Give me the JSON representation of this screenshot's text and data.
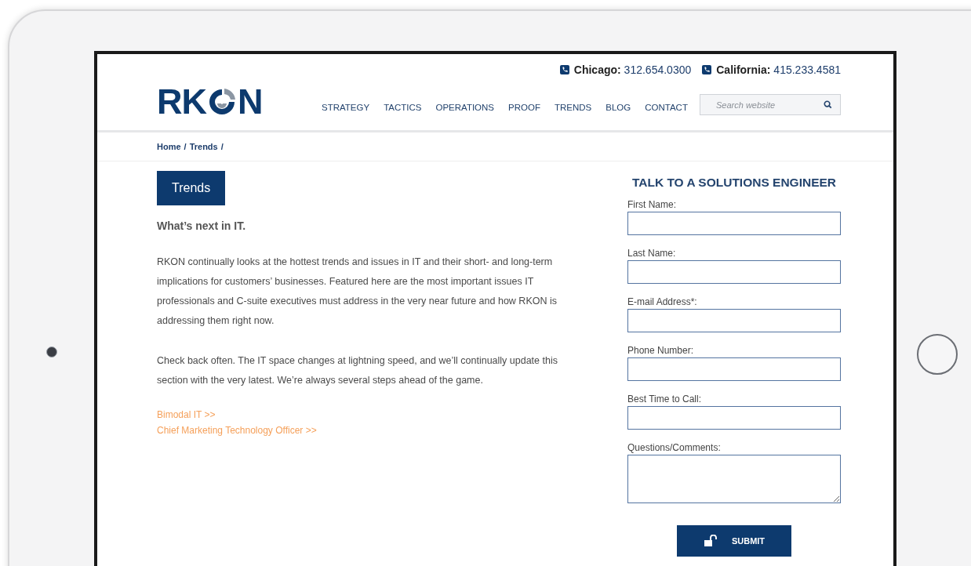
{
  "contacts": [
    {
      "label": "Chicago:",
      "number": "312.654.0300"
    },
    {
      "label": "California:",
      "number": "415.233.4581"
    }
  ],
  "logo": {
    "before": "RK",
    "after": "N"
  },
  "nav": [
    "STRATEGY",
    "TACTICS",
    "OPERATIONS",
    "PROOF",
    "TRENDS",
    "BLOG",
    "CONTACT"
  ],
  "search": {
    "placeholder": "Search website"
  },
  "breadcrumb": [
    {
      "label": "Home",
      "separator": "/"
    },
    {
      "label": "Trends",
      "separator": "/"
    }
  ],
  "page_title": "Trends",
  "subtitle": "What’s next in IT.",
  "paragraphs": [
    "RKON continually looks at the hottest trends and issues in IT and their short- and long-term implications for customers’ businesses. Featured here are the most important issues IT professionals and C-suite executives must address in the very near future and how RKON is addressing them right now.",
    "Check back often. The IT space changes at lightning speed, and we’ll continually update this section with the very latest. We’re always several steps ahead of the game."
  ],
  "links": [
    "Bimodal IT >>",
    "Chief Marketing Technology Officer >>"
  ],
  "form": {
    "title": "TALK TO A SOLUTIONS ENGINEER",
    "fields": [
      {
        "label": "First Name:",
        "kind": "text"
      },
      {
        "label": "Last Name:",
        "kind": "text"
      },
      {
        "label": "E-mail Address*:",
        "kind": "text"
      },
      {
        "label": "Phone Number:",
        "kind": "text"
      },
      {
        "label": "Best Time to Call:",
        "kind": "text"
      },
      {
        "label": "Questions/Comments:",
        "kind": "textarea"
      }
    ],
    "submit": "SUBMIT"
  }
}
